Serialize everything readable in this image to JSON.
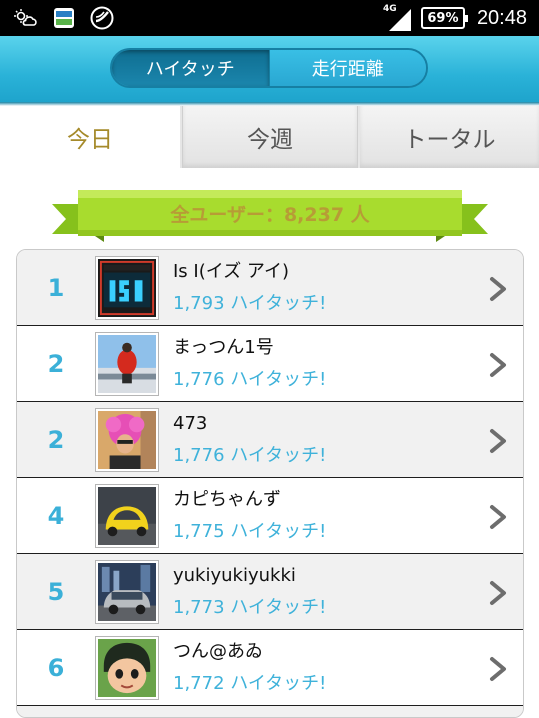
{
  "status_bar": {
    "icons": [
      "weather-icon",
      "app-badge-icon",
      "circle-app-icon"
    ],
    "network_label": "4G",
    "battery": "69%",
    "time": "20:48"
  },
  "segment": {
    "left_label": "ハイタッチ",
    "right_label": "走行距離",
    "selected": "ハイタッチ"
  },
  "tabs": {
    "today": "今日",
    "week": "今週",
    "total": "トータル",
    "selected": "今日"
  },
  "banner": {
    "text": "全ユーザー：8,237 人",
    "color": "#b79c36",
    "ribbon_color": "#9ed62a"
  },
  "ranking": [
    {
      "rank": "1",
      "name": "Is I(イズ アイ)",
      "count": "1,793 ハイタッチ!",
      "avatar": "is-i-logo-avatar"
    },
    {
      "rank": "2",
      "name": "まっつん1号",
      "count": "1,776 ハイタッチ!",
      "avatar": "red-jacket-person-avatar"
    },
    {
      "rank": "2",
      "name": "473",
      "count": "1,776 ハイタッチ!",
      "avatar": "pink-afro-avatar"
    },
    {
      "rank": "4",
      "name": "カピちゃんず",
      "count": "1,775 ハイタッチ!",
      "avatar": "yellow-car-avatar"
    },
    {
      "rank": "5",
      "name": "yukiyukiyukki",
      "count": "1,773 ハイタッチ!",
      "avatar": "station-wagon-avatar"
    },
    {
      "rank": "6",
      "name": "つん@あゐ",
      "count": "1,772 ハイタッチ!",
      "avatar": "cartoon-boy-avatar"
    }
  ],
  "accent_color": "#3bb0d8"
}
